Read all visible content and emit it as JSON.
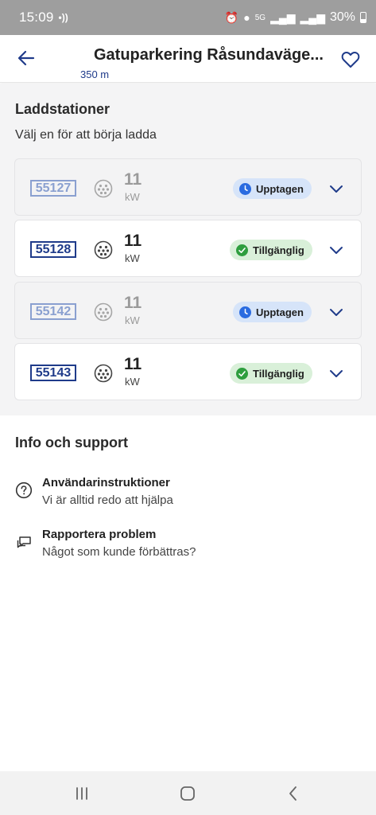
{
  "status_bar": {
    "time": "15:09",
    "network": "5G",
    "battery": "30%"
  },
  "header": {
    "title": "Gatuparkering Råsundaväge...",
    "distance": "350 m"
  },
  "chargers_section": {
    "title": "Laddstationer",
    "subtitle": "Välj en för att börja ladda",
    "items": [
      {
        "id": "55127",
        "power": "11",
        "unit": "kW",
        "status": "Upptagen",
        "state": "busy"
      },
      {
        "id": "55128",
        "power": "11",
        "unit": "kW",
        "status": "Tillgänglig",
        "state": "available"
      },
      {
        "id": "55142",
        "power": "11",
        "unit": "kW",
        "status": "Upptagen",
        "state": "busy"
      },
      {
        "id": "55143",
        "power": "11",
        "unit": "kW",
        "status": "Tillgänglig",
        "state": "available"
      }
    ]
  },
  "info_section": {
    "title": "Info och support",
    "items": [
      {
        "title": "Användarinstruktioner",
        "subtitle": "Vi är alltid redo att hjälpa",
        "icon": "help-circle-icon"
      },
      {
        "title": "Rapportera problem",
        "subtitle": "Något som kunde förbättras?",
        "icon": "chat-bubbles-icon"
      }
    ]
  },
  "colors": {
    "brand": "#1f3b8a",
    "busy_badge": "#d6e4f9",
    "available_badge": "#d9f0d9",
    "busy_icon": "#2a6be0",
    "available_icon": "#2e9e3e"
  }
}
